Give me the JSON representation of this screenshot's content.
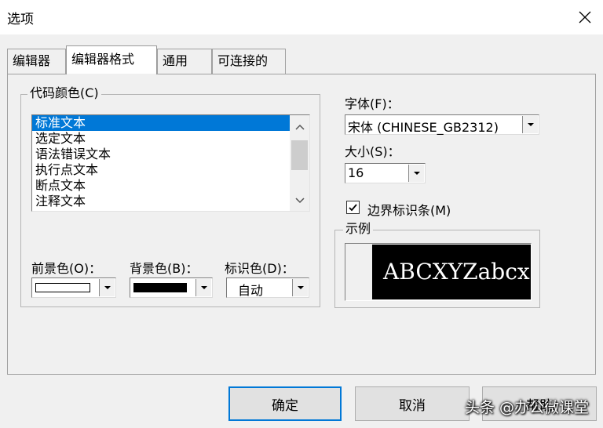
{
  "window": {
    "title": "选项"
  },
  "tabs": [
    {
      "label": "编辑器"
    },
    {
      "label": "编辑器格式",
      "active": true
    },
    {
      "label": "通用"
    },
    {
      "label": "可连接的"
    }
  ],
  "code_colors": {
    "group_label": "代码颜色(C)",
    "items": [
      "标准文本",
      "选定文本",
      "语法错误文本",
      "执行点文本",
      "断点文本",
      "注释文本"
    ],
    "selected_index": 0,
    "foreground_label": "前景色(O)：",
    "background_label": "背景色(B)：",
    "indicator_label": "标识色(D)：",
    "indicator_value": "自动",
    "foreground_swatch_color": "#ffffff",
    "background_swatch_color": "#000000"
  },
  "font": {
    "label": "字体(F)：",
    "value": "宋体 (CHINESE_GB2312)"
  },
  "size": {
    "label": "大小(S)：",
    "value": "16"
  },
  "margin_indicator": {
    "label": "边界标识条(M)",
    "checked": true
  },
  "sample": {
    "label": "示例",
    "text": "ABCXYZabcx"
  },
  "buttons": {
    "ok": "确定",
    "cancel": "取消",
    "help": "帮助"
  },
  "watermark": "头条 @办公微课堂",
  "colors": {
    "selection": "#0078d7",
    "default_button_border": "#0078d7"
  }
}
